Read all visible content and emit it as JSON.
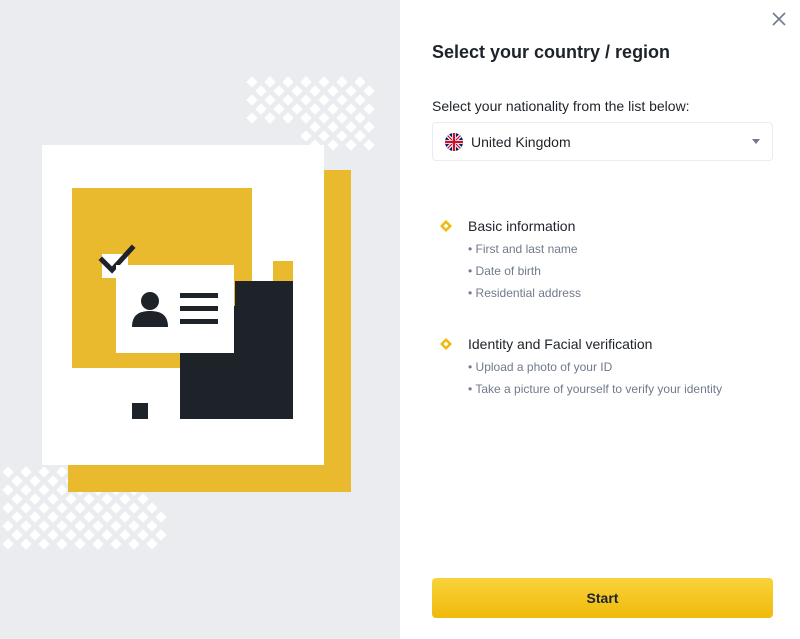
{
  "dialog": {
    "title": "Select your country / region",
    "close_icon": "close-icon"
  },
  "nationality": {
    "label": "Select your nationality from the list below:",
    "selected": "United Kingdom",
    "flag_icon": "uk-flag-icon"
  },
  "sections": [
    {
      "title": "Basic information",
      "items": [
        "First and last name",
        "Date of birth",
        "Residential address"
      ]
    },
    {
      "title": "Identity and Facial verification",
      "items": [
        "Upload a photo of your ID",
        "Take a picture of yourself to verify your identity"
      ]
    }
  ],
  "actions": {
    "start_label": "Start"
  },
  "colors": {
    "accent": "#F0B90B",
    "text_primary": "#1E2329",
    "text_secondary": "#707A8A",
    "panel_bg": "#EAECEF"
  }
}
